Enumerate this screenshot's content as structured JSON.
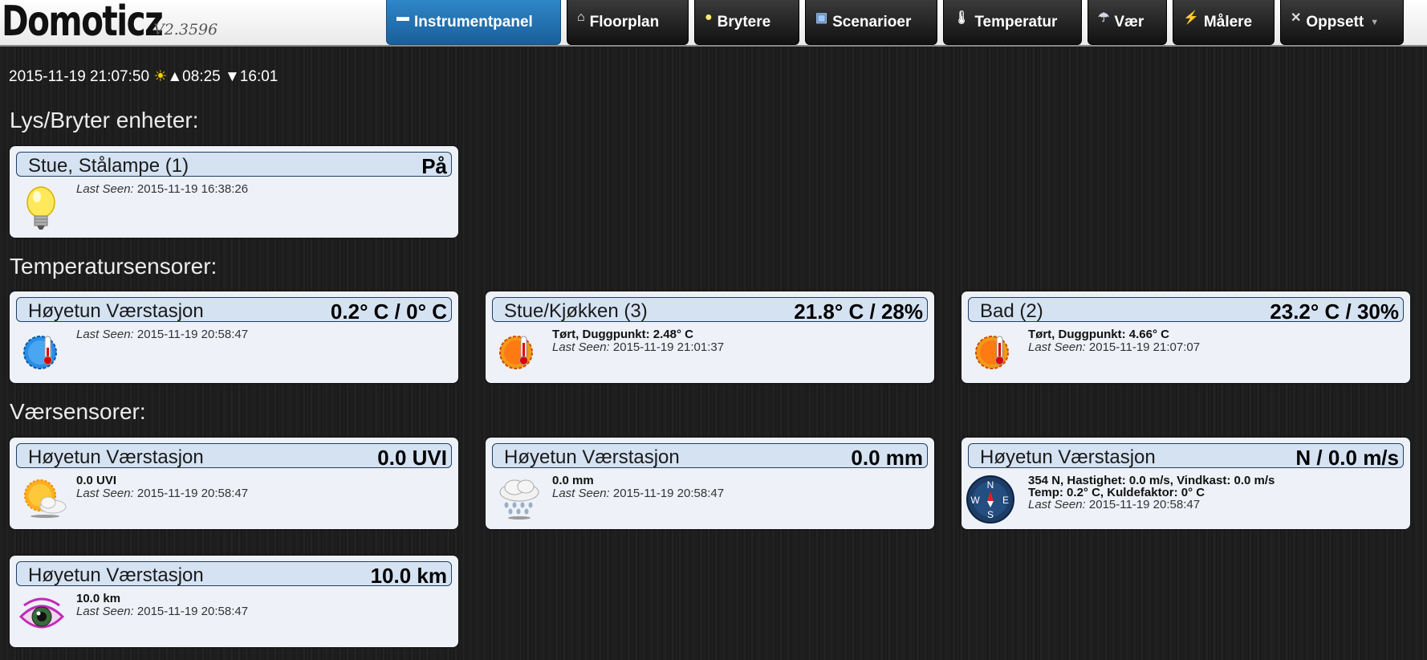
{
  "app": {
    "logo": "Domoticz",
    "version": "V2.3596"
  },
  "nav": [
    {
      "label": "Instrumentpanel",
      "icon": "dashboard-icon",
      "glyph": "▬",
      "active": true
    },
    {
      "label": "Floorplan",
      "icon": "floorplan-icon",
      "glyph": "⌂"
    },
    {
      "label": "Brytere",
      "icon": "lightbulb-icon",
      "glyph": "●"
    },
    {
      "label": "Scenarioer",
      "icon": "scene-icon",
      "glyph": "▣"
    },
    {
      "label": "Temperatur",
      "icon": "thermometer-icon",
      "glyph": "🌡"
    },
    {
      "label": "Vær",
      "icon": "weather-icon",
      "glyph": "☂"
    },
    {
      "label": "Målere",
      "icon": "meter-icon",
      "glyph": "⚡"
    },
    {
      "label": "Oppsett",
      "icon": "settings-icon",
      "glyph": "✕",
      "dropdown": true
    }
  ],
  "status": {
    "datetime": "2015-11-19 21:07:50",
    "sun_icon": "☀",
    "sunrise": "▲08:25",
    "sunset": "▼16:01"
  },
  "sections": {
    "lights": "Lys/Bryter enheter:",
    "temperature": "Temperatursensorer:",
    "weather": "Værsensorer:"
  },
  "last_seen_label": "Last Seen:",
  "cards": {
    "lamp": {
      "name": "Stue, Stålampe (1)",
      "value": "På",
      "last_seen": "2015-11-19 16:38:26",
      "icon": "lightbulb-icon"
    },
    "temp1": {
      "name": "Høyetun Værstasjon",
      "value": "0.2° C / 0° C",
      "last_seen": "2015-11-19 20:58:47",
      "icon": "cold-thermometer-icon"
    },
    "temp2": {
      "name": "Stue/Kjøkken (3)",
      "value": "21.8° C / 28%",
      "detail": "Tørt, Duggpunkt: 2.48° C",
      "last_seen": "2015-11-19 21:01:37",
      "icon": "warm-thermometer-icon"
    },
    "temp3": {
      "name": "Bad (2)",
      "value": "23.2° C / 30%",
      "detail": "Tørt, Duggpunkt: 4.66° C",
      "last_seen": "2015-11-19 21:07:07",
      "icon": "warm-thermometer-icon"
    },
    "uv": {
      "name": "Høyetun Værstasjon",
      "value": "0.0 UVI",
      "detail": "0.0 UVI",
      "last_seen": "2015-11-19 20:58:47",
      "icon": "sun-cloud-icon"
    },
    "rain": {
      "name": "Høyetun Værstasjon",
      "value": "0.0 mm",
      "detail": "0.0 mm",
      "last_seen": "2015-11-19 20:58:47",
      "icon": "rain-cloud-icon"
    },
    "wind": {
      "name": "Høyetun Værstasjon",
      "value": "N / 0.0 m/s",
      "detail": "354 N, Hastighet: 0.0 m/s, Vindkast: 0.0 m/s",
      "detail2": "Temp: 0.2° C, Kuldefaktor: 0° C",
      "last_seen": "2015-11-19 20:58:47",
      "icon": "compass-icon"
    },
    "visibility": {
      "name": "Høyetun Værstasjon",
      "value": "10.0 km",
      "detail": "10.0 km",
      "last_seen": "2015-11-19 20:58:47",
      "icon": "eye-icon"
    }
  },
  "compass": {
    "n": "N",
    "s": "S",
    "e": "E",
    "w": "W"
  }
}
